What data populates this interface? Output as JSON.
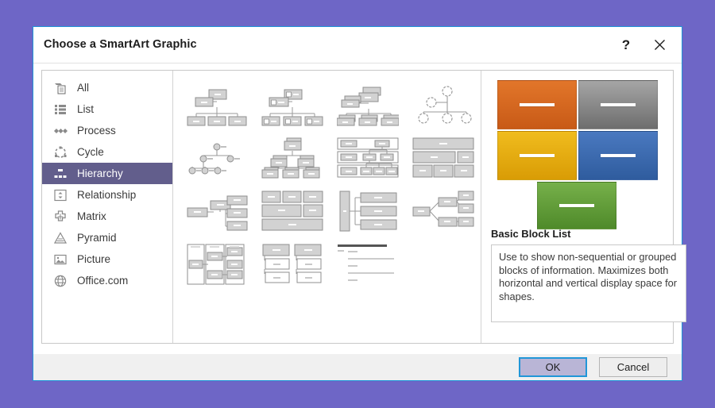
{
  "window": {
    "title": "Choose a SmartArt Graphic",
    "help_icon": "?",
    "help_icon_name": "help-icon",
    "close_icon_name": "close-icon",
    "accent_border": "#2196d8",
    "desktop_background": "#6e66c6"
  },
  "sidebar": {
    "selected": "Hierarchy",
    "selection_color": "#625e8c",
    "items": [
      {
        "label": "All",
        "icon": "all-icon"
      },
      {
        "label": "List",
        "icon": "list-icon"
      },
      {
        "label": "Process",
        "icon": "process-icon"
      },
      {
        "label": "Cycle",
        "icon": "cycle-icon"
      },
      {
        "label": "Hierarchy",
        "icon": "hierarchy-icon"
      },
      {
        "label": "Relationship",
        "icon": "relationship-icon"
      },
      {
        "label": "Matrix",
        "icon": "matrix-icon"
      },
      {
        "label": "Pyramid",
        "icon": "pyramid-icon"
      },
      {
        "label": "Picture",
        "icon": "picture-icon"
      },
      {
        "label": "Office.com",
        "icon": "globe-icon"
      }
    ]
  },
  "gallery": {
    "columns": 4,
    "thumbnails": [
      {
        "id": "organization-chart",
        "shape": "org-chart"
      },
      {
        "id": "name-and-title-org-chart",
        "shape": "org-chart-name-title"
      },
      {
        "id": "half-circle-organization-chart",
        "shape": "org-chart-stacked"
      },
      {
        "id": "circle-picture-hierarchy",
        "shape": "org-chart-circles"
      },
      {
        "id": "labeled-hierarchy",
        "shape": "node-tree-small"
      },
      {
        "id": "hierarchy",
        "shape": "org-chart-layered"
      },
      {
        "id": "horizontal-hierarchy",
        "shape": "boxed-hierarchy"
      },
      {
        "id": "table-hierarchy",
        "shape": "table-hierarchy"
      },
      {
        "id": "horizontal-labeled-hierarchy",
        "shape": "side-hierarchy"
      },
      {
        "id": "architecture-layout",
        "shape": "block-layout"
      },
      {
        "id": "hierarchy-list",
        "shape": "bar-and-boxes"
      },
      {
        "id": "horizontal-multi-level",
        "shape": "branching-right"
      },
      {
        "id": "lined-list",
        "shape": "column-nested"
      },
      {
        "id": "picture-org-chart",
        "shape": "two-column-stack"
      },
      {
        "id": "horizontal-organization-chart",
        "shape": "lines-list"
      }
    ]
  },
  "preview": {
    "name": "Basic Block List",
    "description": "Use to show non-sequential or grouped blocks of information. Maximizes both horizontal and vertical display space for shapes.",
    "blocks": [
      {
        "color_top": "#e2762a",
        "color_bottom": "#c85a17",
        "position": "top-left"
      },
      {
        "color_top": "#a5a5a5",
        "color_bottom": "#6e6e6e",
        "position": "top-right"
      },
      {
        "color_top": "#f0bc1e",
        "color_bottom": "#d99c05",
        "position": "middle-left"
      },
      {
        "color_top": "#4a79c0",
        "color_bottom": "#2f5c9e",
        "position": "middle-right"
      },
      {
        "color_top": "#76b04a",
        "color_bottom": "#4f8a2a",
        "position": "bottom-center"
      }
    ]
  },
  "footer": {
    "ok_label": "OK",
    "cancel_label": "Cancel"
  }
}
